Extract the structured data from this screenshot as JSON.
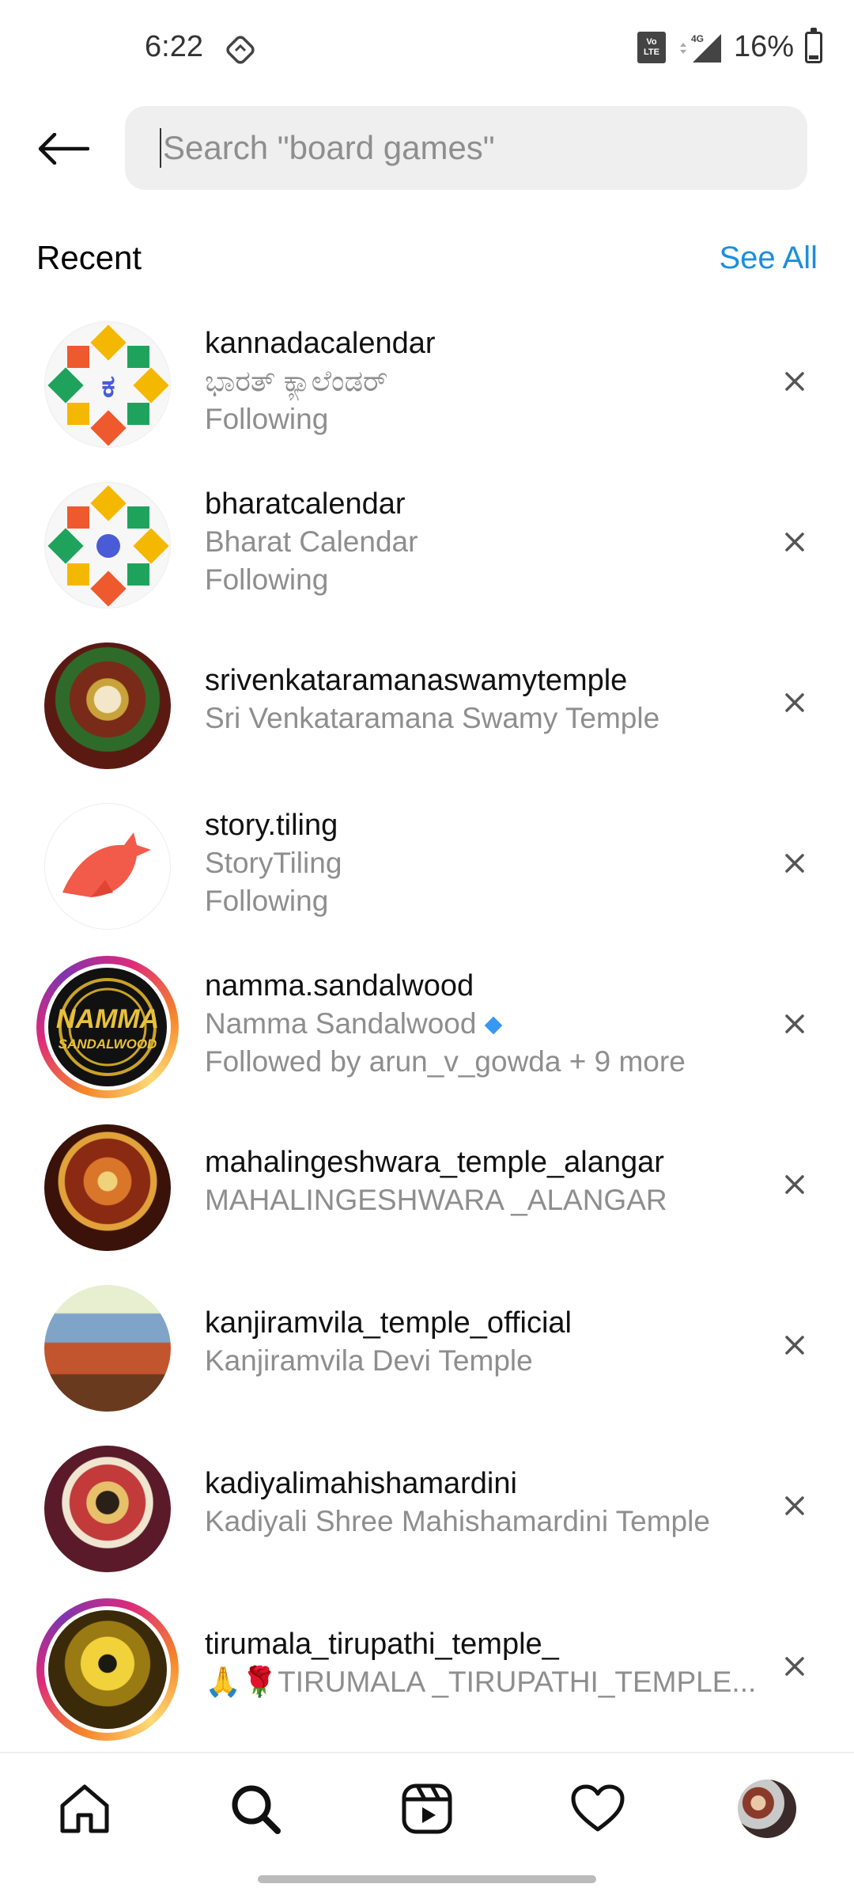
{
  "status_bar": {
    "time": "6:22",
    "network": "4G",
    "battery": "16%",
    "battery_level": 0.16,
    "icons": [
      "sync-icon",
      "volte-icon",
      "signal-icon",
      "battery-icon"
    ]
  },
  "search": {
    "placeholder": "Search \"board games\"",
    "value": ""
  },
  "recent": {
    "title": "Recent",
    "see_all_label": "See All",
    "items": [
      {
        "username": "kannadacalendar",
        "name": "ಭಾರತ್ ಕ್ಯಾಲೆಂಡರ್",
        "meta": "Following",
        "story_ring": false
      },
      {
        "username": "bharatcalendar",
        "name": "Bharat Calendar",
        "meta": "Following",
        "story_ring": false
      },
      {
        "username": "srivenkataramanaswamytemple",
        "name": "Sri Venkataramana Swamy Temple",
        "meta": "",
        "story_ring": false
      },
      {
        "username": "story.tiling",
        "name": "StoryTiling",
        "meta": "Following",
        "story_ring": false
      },
      {
        "username": "namma.sandalwood",
        "name": "Namma Sandalwood",
        "meta": "Followed by arun_v_gowda + 9 more",
        "story_ring": true,
        "verified": true,
        "avatar_text_top": "NAMMA",
        "avatar_text_bottom": "SANDALWOOD"
      },
      {
        "username": "mahalingeshwara_temple_alangar",
        "name": "MAHALINGESHWARA _ALANGAR",
        "meta": "",
        "story_ring": false
      },
      {
        "username": "kanjiramvila_temple_official",
        "name": "Kanjiramvila Devi Temple",
        "meta": "",
        "story_ring": false
      },
      {
        "username": "kadiyalimahishamardini",
        "name": "Kadiyali Shree Mahishamardini Temple",
        "meta": "",
        "story_ring": false
      },
      {
        "username": "tirumala_tirupathi_temple_",
        "name": "🙏🌹TIRUMALA _TIRUPATHI_TEMPLE...",
        "meta": "",
        "story_ring": true
      }
    ]
  },
  "kannada_letter": "ಕ",
  "bottom_nav": {
    "items": [
      "home-icon",
      "search-icon",
      "reels-icon",
      "heart-icon",
      "profile-avatar"
    ]
  },
  "colors": {
    "accent": "#1a8fdd",
    "secondary_text": "#8e8e8e",
    "search_bg": "#efefef"
  }
}
